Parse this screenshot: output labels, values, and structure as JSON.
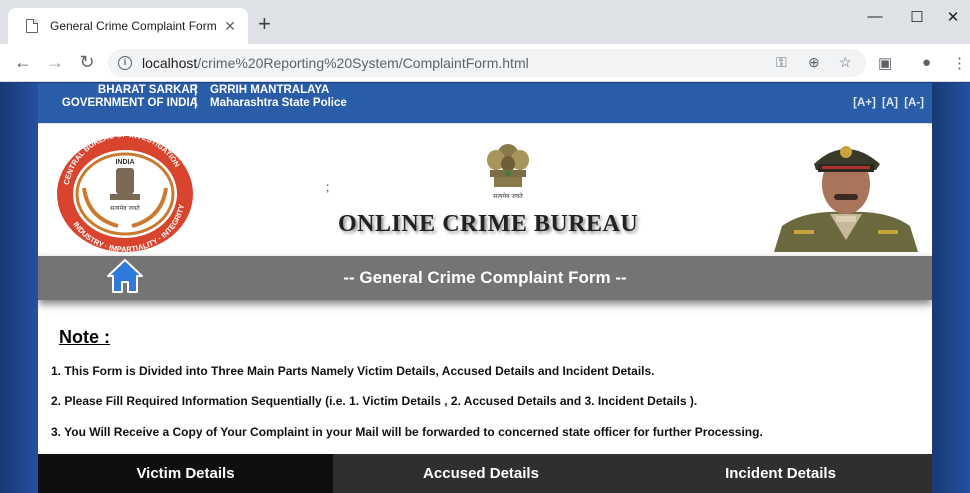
{
  "browser": {
    "tab_title": "General Crime Complaint Form",
    "tab_close": "✕",
    "new_tab": "+",
    "minimize": "—",
    "maximize": "☐",
    "close": "✕",
    "url_host": "localhost",
    "url_path": "/crime%20Reporting%20System/ComplaintForm.html",
    "back": "←",
    "forward": "→",
    "reload": "↻"
  },
  "header": {
    "left_line1": "BHARAT SARKAR",
    "left_line2": "GOVERNMENT OF INDIA",
    "sep": "|",
    "right_line1": "GRRIH MANTRALAYA",
    "right_line2": "Maharashtra State Police",
    "font_increase": "[A+]",
    "font_normal": "[A]",
    "font_decrease": "[A-]"
  },
  "banner": {
    "semicolon": ";",
    "site_title": "ONLINE CRIME BUREAU",
    "cbi_logo_top": "CENTRAL BUREAU OF INVESTIGATION",
    "cbi_logo_india": "INDIA",
    "cbi_logo_motto": "सत्यमेव जयते",
    "cbi_logo_bottom": "INDUSTRY · IMPARTIALITY · INTEGRITY",
    "emblem_motto": "सत्यमेव जयते"
  },
  "form_bar": {
    "title": "-- General Crime Complaint Form --"
  },
  "note": {
    "heading": "Note :",
    "items": [
      "1. This Form is Divided into Three Main Parts Namely Victim Details, Accused Details and Incident Details.",
      "2. Please Fill Required Information Sequentially (i.e. 1. Victim Details , 2. Accused Details and 3. Incident Details ).",
      "3. You Will Receive a Copy of Your Complaint in your Mail will be forwarded to concerned state officer for further Processing."
    ]
  },
  "tabs": [
    {
      "label": "Victim Details"
    },
    {
      "label": "Accused Details"
    },
    {
      "label": "Incident Details"
    }
  ],
  "colors": {
    "header_blue": "#2a5da8",
    "form_bar_grey": "#747474",
    "tab_active": "#0f0f0f",
    "tab_inactive": "#2f2f2f"
  }
}
